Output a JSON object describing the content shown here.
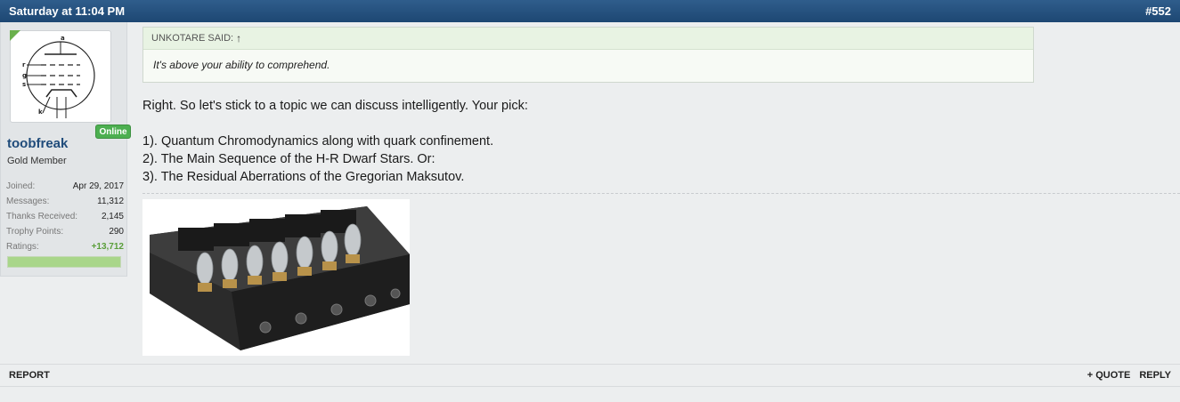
{
  "post": {
    "timestamp": "Saturday at 11:04 PM",
    "number": "#552"
  },
  "user": {
    "name": "toobfreak",
    "title": "Gold Member",
    "online_label": "Online",
    "stats": [
      {
        "key": "Joined:",
        "value": "Apr 29, 2017"
      },
      {
        "key": "Messages:",
        "value": "11,312"
      },
      {
        "key": "Thanks Received:",
        "value": "2,145"
      },
      {
        "key": "Trophy Points:",
        "value": "290"
      },
      {
        "key": "Ratings:",
        "value": "+13,712"
      }
    ],
    "rating_level": 1.0,
    "avatar_labels": {
      "a": "a",
      "r": "r",
      "g": "g",
      "s": "s",
      "k": "k"
    }
  },
  "quote": {
    "author": "UNKOTARE SAID:",
    "text": "It's above your ability to comprehend."
  },
  "message": {
    "intro": "Right. So let's stick to a topic we can discuss intelligently. Your pick:",
    "options": [
      "1). Quantum Chromodynamics along with quark confinement.",
      "2). The Main Sequence of the H-R Dwarf Stars. Or:",
      "3). The Residual Aberrations of the Gregorian Maksutov."
    ]
  },
  "actions": {
    "report": "REPORT",
    "quote": "+ QUOTE",
    "reply": "REPLY"
  }
}
